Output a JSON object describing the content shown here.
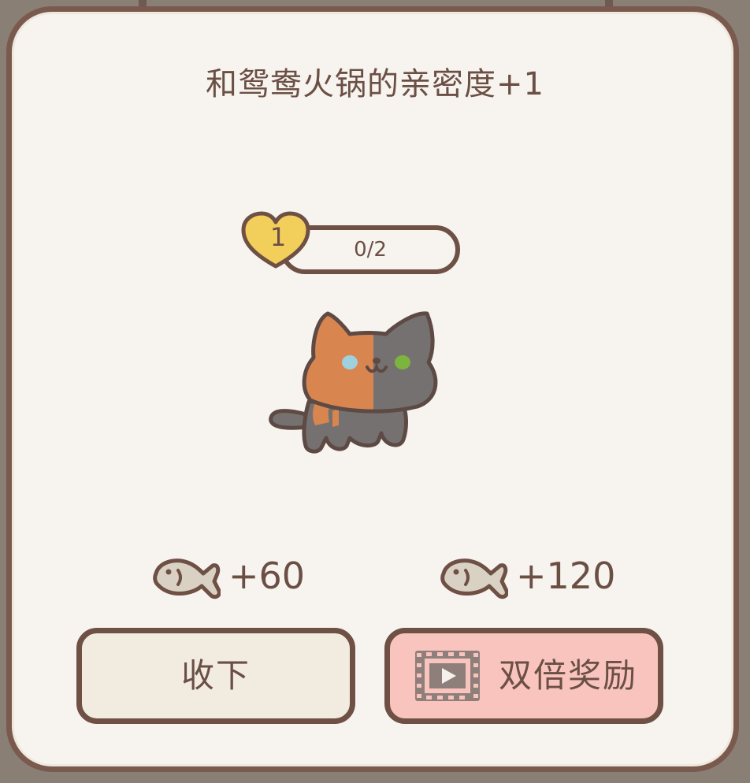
{
  "dialog": {
    "title": "和鸳鸯火锅的亲密度+1"
  },
  "affection": {
    "level": "1",
    "progress_text": "0/2",
    "progress_fraction": 0
  },
  "rewards": {
    "single": {
      "icon": "fish-icon",
      "value": "+60"
    },
    "double": {
      "icon": "fish-icon",
      "value": "+120"
    }
  },
  "buttons": {
    "accept_label": "收下",
    "double_label": "双倍奖励",
    "double_icon": "video-film-icon"
  },
  "colors": {
    "panel_bg": "#f7f4ef",
    "border": "#7a5a4e",
    "text": "#6b4f45",
    "heart": "#f2cf5a",
    "accept_button": "#f2ece0",
    "double_button": "#f8c4bd"
  }
}
